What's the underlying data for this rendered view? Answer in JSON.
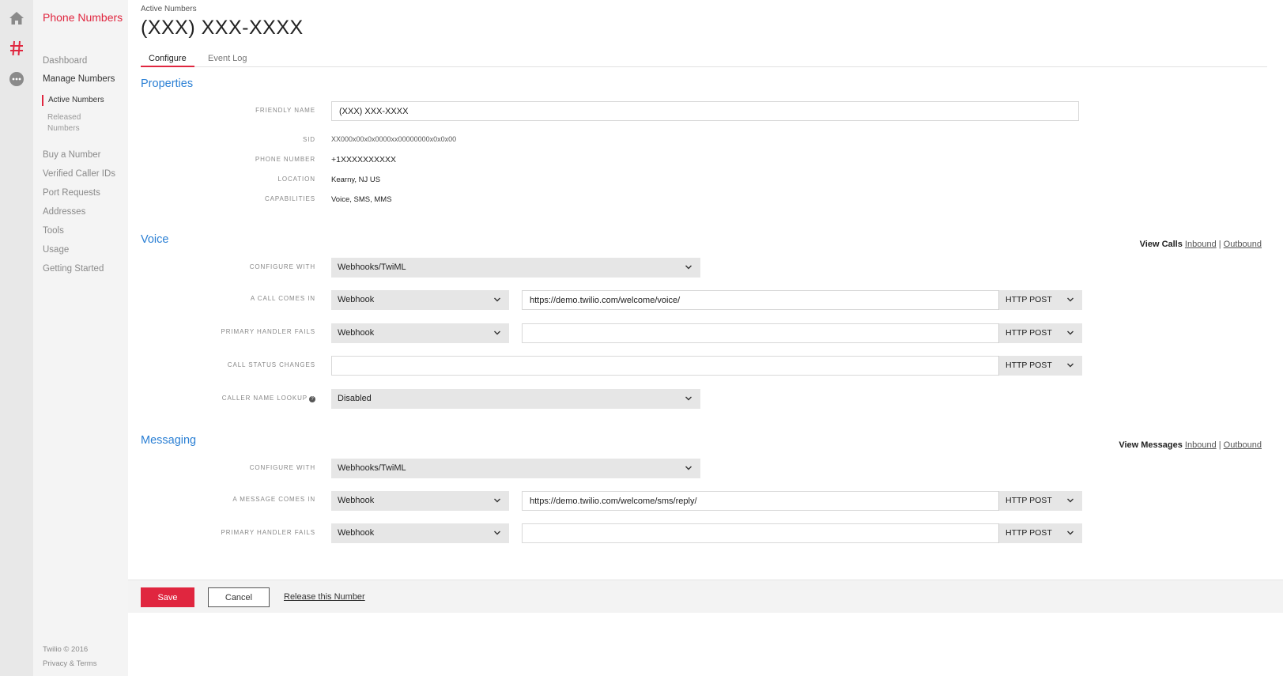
{
  "rail": {
    "icons": [
      "home-icon",
      "hash-icon",
      "more-icon"
    ],
    "accent": "#e0263f"
  },
  "sidebar": {
    "title": "Phone Numbers",
    "dashboard": "Dashboard",
    "manage_numbers": "Manage Numbers",
    "active_numbers": "Active Numbers",
    "released_numbers": "Released Numbers",
    "buy_number": "Buy a Number",
    "verified_caller_ids": "Verified Caller IDs",
    "port_requests": "Port Requests",
    "addresses": "Addresses",
    "tools": "Tools",
    "usage": "Usage",
    "getting_started": "Getting Started",
    "copyright": "Twilio © 2016",
    "privacy_terms": "Privacy & Terms"
  },
  "header": {
    "breadcrumb": "Active Numbers",
    "title": "(XXX) XXX-XXXX",
    "tabs": [
      "Configure",
      "Event Log"
    ],
    "active_tab": "Configure"
  },
  "properties": {
    "section_title": "Properties",
    "friendly_name_label": "Friendly Name",
    "friendly_name_value": "(XXX) XXX-XXXX",
    "sid_label": "SID",
    "sid_value": "XX000x00x0x0000xx00000000x0x0x00",
    "phone_number_label": "Phone Number",
    "phone_number_value": "+1XXXXXXXXXX",
    "location_label": "Location",
    "location_value": "Kearny, NJ US",
    "capabilities_label": "Capabilities",
    "capabilities_value": "Voice, SMS, MMS"
  },
  "voice": {
    "section_title": "Voice",
    "view_label": "View Calls",
    "inbound": "Inbound",
    "separator": "|",
    "outbound": "Outbound",
    "configure_with_label": "Configure With",
    "configure_with_value": "Webhooks/TwiML",
    "call_comes_in_label": "A Call Comes In",
    "call_comes_in_type": "Webhook",
    "call_comes_in_url": "https://demo.twilio.com/welcome/voice/",
    "call_comes_in_method": "HTTP POST",
    "primary_fails_label": "Primary Handler Fails",
    "primary_fails_type": "Webhook",
    "primary_fails_url": "",
    "primary_fails_method": "HTTP POST",
    "status_changes_label": "Call Status Changes",
    "status_changes_url": "",
    "status_changes_method": "HTTP POST",
    "caller_name_label": "Caller Name Lookup",
    "caller_name_value": "Disabled"
  },
  "messaging": {
    "section_title": "Messaging",
    "view_label": "View Messages",
    "inbound": "Inbound",
    "separator": "|",
    "outbound": "Outbound",
    "configure_with_label": "Configure With",
    "configure_with_value": "Webhooks/TwiML",
    "message_comes_in_label": "A Message Comes In",
    "message_comes_in_type": "Webhook",
    "message_comes_in_url": "https://demo.twilio.com/welcome/sms/reply/",
    "message_comes_in_method": "HTTP POST",
    "primary_fails_label": "Primary Handler Fails",
    "primary_fails_type": "Webhook",
    "primary_fails_url": "",
    "primary_fails_method": "HTTP POST"
  },
  "actions": {
    "save": "Save",
    "cancel": "Cancel",
    "release": "Release this Number"
  }
}
